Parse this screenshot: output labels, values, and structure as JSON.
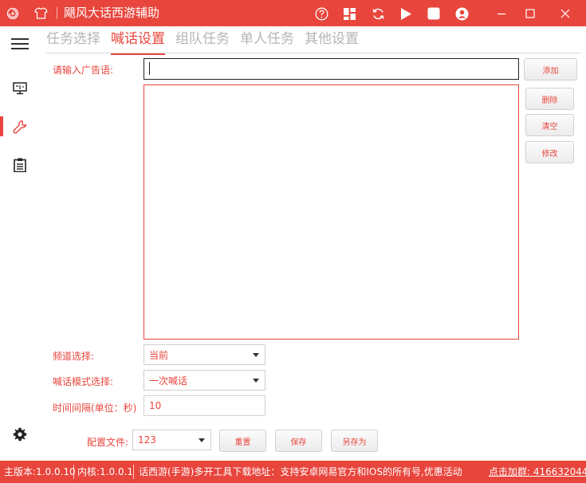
{
  "window": {
    "title": "飓风大话西游辅助",
    "accent": "#e8453c"
  },
  "titlebar_icons": [
    "app-logo-icon",
    "shirt-icon",
    "help-icon",
    "grid-icon",
    "refresh-icon",
    "play-icon",
    "stop-icon",
    "user-icon",
    "minimize-icon",
    "maximize-icon",
    "close-icon"
  ],
  "tabs": [
    {
      "label": "任务选择",
      "active": false
    },
    {
      "label": "喊话设置",
      "active": true
    },
    {
      "label": "组队任务",
      "active": false
    },
    {
      "label": "单人任务",
      "active": false
    },
    {
      "label": "其他设置",
      "active": false
    }
  ],
  "ad": {
    "label": "请输入广告语:",
    "value": ""
  },
  "buttons": {
    "add": "添加",
    "delete": "删除",
    "clear": "清空",
    "modify": "修改",
    "reset": "重置",
    "save": "保存",
    "save_as": "另存为"
  },
  "channel": {
    "label": "频道选择:",
    "value": "当前"
  },
  "shout_mode": {
    "label": "喊话模式选择:",
    "value": "一次喊话"
  },
  "interval": {
    "label": "时间间隔(单位：秒)",
    "value": "10"
  },
  "config": {
    "label": "配置文件:",
    "value": "123"
  },
  "status": {
    "version": "主版本:1.0.0.10",
    "kernel": "内核:1.0.0.1",
    "notice": "话西游(手游)多开工具下载地址：支持安卓网易官方和IOS的所有号,优惠活动",
    "group": "点击加群: 416632044"
  }
}
